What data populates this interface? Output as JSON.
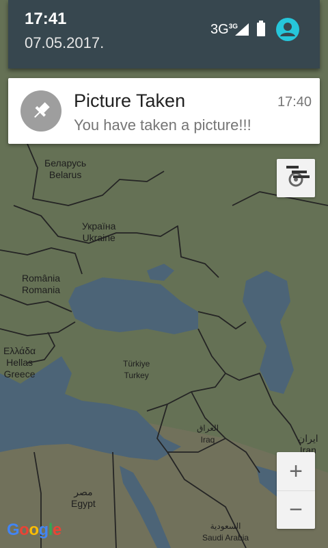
{
  "status": {
    "time": "17:41",
    "date": "07.05.2017.",
    "network": "3G",
    "network_sup": "3G"
  },
  "notification": {
    "title": "Picture Taken",
    "text": "You have taken a picture!!!",
    "time": "17:40",
    "icon": "pin-icon"
  },
  "map": {
    "labels": {
      "belarus": "Беларусь\nBelarus",
      "ukraine": "Україна\nUkraine",
      "romania": "România\nRomania",
      "greece": "Ελλάδα\nHellas\nGreece",
      "turkey": "Türkiye\nTurkey",
      "iraq": "العراق\nIraq",
      "iran": "ایران\nIran",
      "egypt": "مصر\nEgypt",
      "saudi": "السعودية\nSaudi Arabia"
    },
    "attribution": "Google",
    "zoom_in": "+",
    "zoom_out": "−"
  },
  "colors": {
    "land": "#7c8a68",
    "water": "#5d7a92",
    "shade": "#37474f",
    "avatar": "#26c6da"
  }
}
